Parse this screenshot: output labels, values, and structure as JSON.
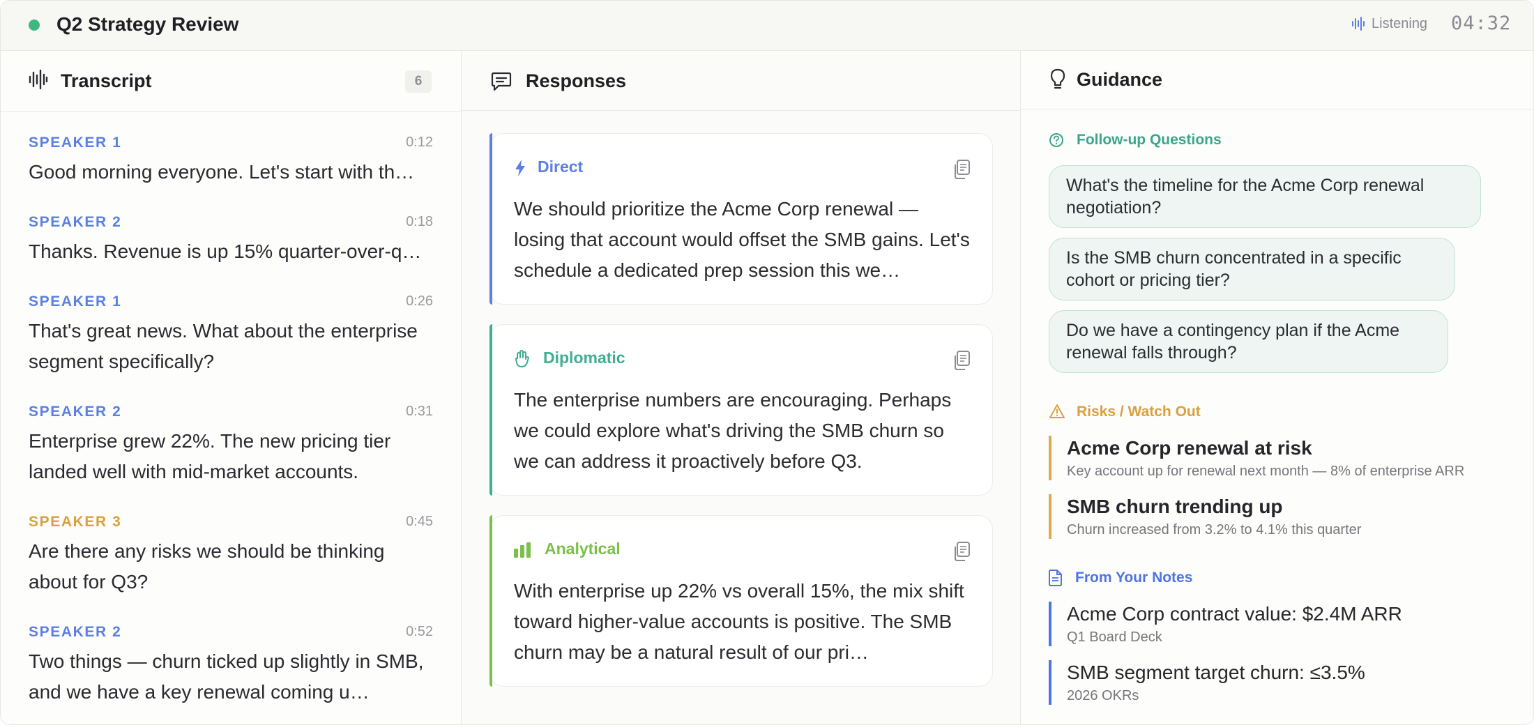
{
  "header": {
    "title": "Q2 Strategy Review",
    "status": "Listening",
    "timer": "04:32",
    "live_color": "#3fb87f"
  },
  "transcript": {
    "title": "Transcript",
    "icon": "waveform-icon",
    "count": "6",
    "entries": [
      {
        "speaker": "SPEAKER 1",
        "time": "0:12",
        "text": "Good morning everyone. Let's start with th…",
        "color": "#5b7fe3"
      },
      {
        "speaker": "SPEAKER 2",
        "time": "0:18",
        "text": "Thanks. Revenue is up 15% quarter-over-q…",
        "color": "#5b7fe3"
      },
      {
        "speaker": "SPEAKER 1",
        "time": "0:26",
        "text": "That's great news. What about the enterprise segment specifically?",
        "color": "#5b7fe3"
      },
      {
        "speaker": "SPEAKER 2",
        "time": "0:31",
        "text": "Enterprise grew 22%. The new pricing tier landed well with mid-market accounts.",
        "color": "#5b7fe3"
      },
      {
        "speaker": "SPEAKER 3",
        "time": "0:45",
        "text": "Are there any risks we should be thinking about for Q3?",
        "color": "#d8a13c"
      },
      {
        "speaker": "SPEAKER 2",
        "time": "0:52",
        "text": "Two things — churn ticked up slightly in SMB, and we have a key renewal coming u…",
        "color": "#5b7fe3"
      }
    ]
  },
  "responses": {
    "title": "Responses",
    "icon": "chat-bubble-icon",
    "cards": [
      {
        "label": "Direct",
        "icon": "lightning-icon",
        "color": "#5b7fe3",
        "text": "We should prioritize the Acme Corp renewal — losing that account would offset the SMB gains. Let's schedule a dedicated prep session this we…"
      },
      {
        "label": "Diplomatic",
        "icon": "hands-icon",
        "color": "#3fae93",
        "text": "The enterprise numbers are encouraging. Perhaps we could explore what's driving the SMB churn so we can address it proactively before Q3."
      },
      {
        "label": "Analytical",
        "icon": "bar-chart-icon",
        "color": "#7cbf4a",
        "text": "With enterprise up 22% vs overall 15%, the mix shift toward higher-value accounts is positive. The SMB churn may be a natural result of our pri…"
      }
    ]
  },
  "guidance": {
    "title": "Guidance",
    "icon": "lightbulb-icon",
    "followup": {
      "title": "Follow-up Questions",
      "color": "#3aa58a",
      "questions": [
        "What's the timeline for the Acme Corp renewal negotiation?",
        "Is the SMB churn concentrated in a specific cohort or pricing tier?",
        "Do we have a contingency plan if the Acme renewal falls through?"
      ]
    },
    "risks": {
      "title": "Risks / Watch Out",
      "color": "#d8a13c",
      "items": [
        {
          "title": "Acme Corp renewal at risk",
          "detail": "Key account up for renewal next month — 8% of enterprise ARR"
        },
        {
          "title": "SMB churn trending up",
          "detail": "Churn increased from 3.2% to 4.1% this quarter"
        }
      ]
    },
    "notes": {
      "title": "From Your Notes",
      "color": "#4f74e6",
      "items": [
        {
          "title": "Acme Corp contract value: $2.4M ARR",
          "source": "Q1 Board Deck"
        },
        {
          "title": "SMB segment target churn: ≤3.5%",
          "source": "2026 OKRs"
        }
      ]
    }
  }
}
